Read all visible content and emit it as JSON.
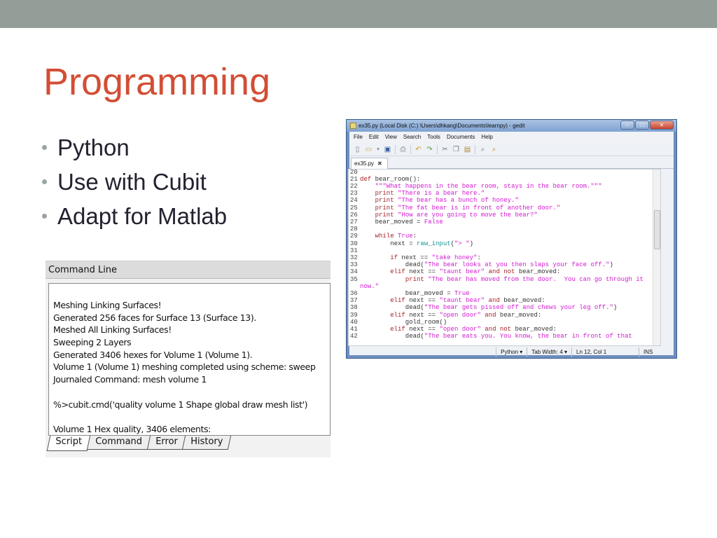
{
  "slide": {
    "title": "Programming",
    "bullets": [
      "Python",
      "Use with Cubit",
      "Adapt for Matlab"
    ]
  },
  "gedit": {
    "title": "ex35.py (Local Disk (C:) \\Users\\dhkang\\Documents\\learnpy) - gedit",
    "menu": [
      "File",
      "Edit",
      "View",
      "Search",
      "Tools",
      "Documents",
      "Help"
    ],
    "tab": "ex35.py",
    "status": {
      "language": "Python ▾",
      "tab_width": "Tab Width: 4 ▾",
      "position": "Ln 12, Col 1",
      "mode": "INS"
    },
    "code": [
      {
        "n": "20",
        "t": []
      },
      {
        "n": "21",
        "t": [
          [
            "def",
            "k"
          ],
          [
            " bear_room():",
            "n"
          ]
        ]
      },
      {
        "n": "22",
        "t": [
          [
            "    ",
            "n"
          ],
          [
            "\"\"\"What happens in the bear room, stays in the bear room.\"\"\"",
            "s"
          ]
        ]
      },
      {
        "n": "23",
        "t": [
          [
            "    ",
            "n"
          ],
          [
            "print",
            "k"
          ],
          [
            " ",
            "n"
          ],
          [
            "\"There is a bear here.\"",
            "s"
          ]
        ]
      },
      {
        "n": "24",
        "t": [
          [
            "    ",
            "n"
          ],
          [
            "print",
            "k"
          ],
          [
            " ",
            "n"
          ],
          [
            "\"The bear has a bunch of honey.\"",
            "s"
          ]
        ]
      },
      {
        "n": "25",
        "t": [
          [
            "    ",
            "n"
          ],
          [
            "print",
            "k"
          ],
          [
            " ",
            "n"
          ],
          [
            "\"The fat bear is in front of another door.\"",
            "s"
          ]
        ]
      },
      {
        "n": "26",
        "t": [
          [
            "    ",
            "n"
          ],
          [
            "print",
            "k"
          ],
          [
            " ",
            "n"
          ],
          [
            "\"How are you going to move the bear?\"",
            "s"
          ]
        ]
      },
      {
        "n": "27",
        "t": [
          [
            "    bear_moved = ",
            "n"
          ],
          [
            "False",
            "s"
          ]
        ]
      },
      {
        "n": "28",
        "t": []
      },
      {
        "n": "29",
        "t": [
          [
            "    ",
            "n"
          ],
          [
            "while",
            "k"
          ],
          [
            " ",
            "n"
          ],
          [
            "True",
            "s"
          ],
          [
            ":",
            "n"
          ]
        ]
      },
      {
        "n": "30",
        "t": [
          [
            "        next = ",
            "n"
          ],
          [
            "raw_input",
            "f"
          ],
          [
            "(",
            "n"
          ],
          [
            "\"> \"",
            "s"
          ],
          [
            ")",
            "n"
          ]
        ]
      },
      {
        "n": "31",
        "t": []
      },
      {
        "n": "32",
        "t": [
          [
            "        ",
            "n"
          ],
          [
            "if",
            "k"
          ],
          [
            " next == ",
            "n"
          ],
          [
            "\"take honey\"",
            "s"
          ],
          [
            ":",
            "n"
          ]
        ]
      },
      {
        "n": "33",
        "t": [
          [
            "            dead(",
            "n"
          ],
          [
            "\"The bear looks at you then slaps your face off.\"",
            "s"
          ],
          [
            ")",
            "n"
          ]
        ]
      },
      {
        "n": "34",
        "t": [
          [
            "        ",
            "n"
          ],
          [
            "elif",
            "k"
          ],
          [
            " next == ",
            "n"
          ],
          [
            "\"taunt bear\"",
            "s"
          ],
          [
            " ",
            "n"
          ],
          [
            "and not",
            "k"
          ],
          [
            " bear_moved:",
            "n"
          ]
        ]
      },
      {
        "n": "35",
        "t": [
          [
            "            ",
            "n"
          ],
          [
            "print",
            "k"
          ],
          [
            " ",
            "n"
          ],
          [
            "\"The bear has moved from the door.  You can go through it",
            "s"
          ]
        ]
      },
      {
        "n": "",
        "t": [
          [
            "now.\"",
            "s"
          ]
        ]
      },
      {
        "n": "36",
        "t": [
          [
            "            bear_moved = ",
            "n"
          ],
          [
            "True",
            "s"
          ]
        ]
      },
      {
        "n": "37",
        "t": [
          [
            "        ",
            "n"
          ],
          [
            "elif",
            "k"
          ],
          [
            " next == ",
            "n"
          ],
          [
            "\"taunt bear\"",
            "s"
          ],
          [
            " ",
            "n"
          ],
          [
            "and",
            "k"
          ],
          [
            " bear_moved:",
            "n"
          ]
        ]
      },
      {
        "n": "38",
        "t": [
          [
            "            dead(",
            "n"
          ],
          [
            "\"The bear gets pissed off and chews your leg off.\"",
            "s"
          ],
          [
            ")",
            "n"
          ]
        ]
      },
      {
        "n": "39",
        "t": [
          [
            "        ",
            "n"
          ],
          [
            "elif",
            "k"
          ],
          [
            " next == ",
            "n"
          ],
          [
            "\"open door\"",
            "s"
          ],
          [
            " ",
            "n"
          ],
          [
            "and",
            "k"
          ],
          [
            " bear_moved:",
            "n"
          ]
        ]
      },
      {
        "n": "40",
        "t": [
          [
            "            gold_room()",
            "n"
          ]
        ]
      },
      {
        "n": "41",
        "t": [
          [
            "        ",
            "n"
          ],
          [
            "elif",
            "k"
          ],
          [
            " next == ",
            "n"
          ],
          [
            "\"open door\"",
            "s"
          ],
          [
            " ",
            "n"
          ],
          [
            "and not",
            "k"
          ],
          [
            " bear_moved:",
            "n"
          ]
        ]
      },
      {
        "n": "42",
        "t": [
          [
            "            dead(",
            "n"
          ],
          [
            "\"The bear eats you. You know, the bear in front of that",
            "s"
          ]
        ]
      }
    ]
  },
  "command_line": {
    "title": "Command Line",
    "lines": [
      "Meshing Linking Surfaces!",
      "Generated 256 faces for Surface 13 (Surface 13).",
      "Meshed All Linking Surfaces!",
      "Sweeping 2 Layers",
      "Generated 3406 hexes for Volume 1 (Volume 1).",
      "Volume 1 (Volume 1) meshing completed using scheme: sweep",
      "Journaled Command: mesh volume 1",
      "",
      "%>cubit.cmd('quality volume 1 Shape global draw mesh list')",
      "",
      "Volume 1 Hex quality, 3406 elements:"
    ],
    "tabs": [
      "Script",
      "Command",
      "Error",
      "History"
    ],
    "active_tab": "Script"
  }
}
